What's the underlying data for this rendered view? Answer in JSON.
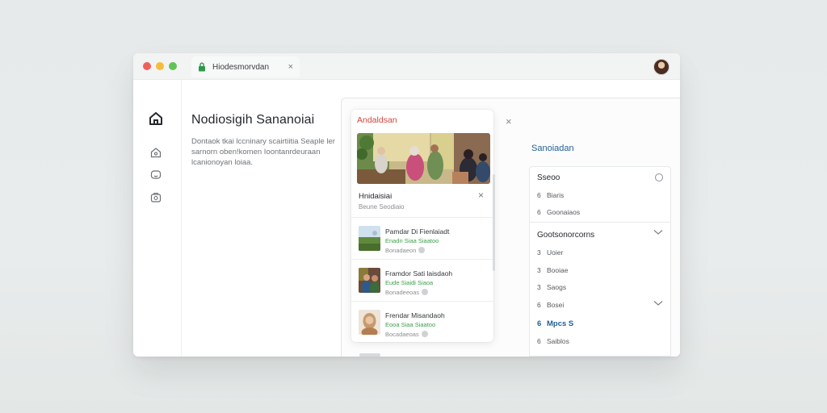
{
  "browser": {
    "tab_title": "Hiodesmorvdan",
    "tab_close": "×"
  },
  "intro": {
    "heading": "Nodiosigih Sananoiai",
    "body": "Dontaok tkai lccninary scairtiitia Seaple ler sarnorn oben!komen Ioontanrdeuraan lcanionoyan loiaa."
  },
  "card": {
    "tag": "Andaldsan",
    "header_title": "Hnidaisiai",
    "header_sub": "Beune Seodiaio",
    "close": "×",
    "items": [
      {
        "title": "Pamdar Di Fienlaiadt",
        "meta": "Enadn Siaa Siaatoo",
        "foot": "Bonadaeon"
      },
      {
        "title": "Framdor Sati laisdaoh",
        "meta": "Eude Siaidi Siaoa",
        "foot": "Bonadeeoas"
      },
      {
        "title": "Frendar Misandaoh",
        "meta": "Eooa Siaa Siaatoo",
        "foot": "Bocadaeoas"
      }
    ]
  },
  "panel": {
    "close": "×"
  },
  "right": {
    "title": "Sanoiadan",
    "group1": {
      "header": "Sseoo",
      "rows": [
        {
          "num": "6",
          "label": "Biaris"
        },
        {
          "num": "6",
          "label": "Goonaiaos"
        }
      ]
    },
    "group2": {
      "header": "Gootsonorcorns",
      "chevron": "⌄",
      "rows": [
        {
          "num": "3",
          "label": "Uoier",
          "active": false
        },
        {
          "num": "3",
          "label": "Booiae",
          "active": false
        },
        {
          "num": "3",
          "label": "Saogs",
          "active": false
        },
        {
          "num": "6",
          "label": "Bosei",
          "active": false
        },
        {
          "num": "6",
          "label": "Mpcs S",
          "active": true
        },
        {
          "num": "6",
          "label": "Saiblos",
          "active": false
        }
      ]
    }
  },
  "colors": {
    "accent_blue": "#1f5f96",
    "tag_red": "#d2453a",
    "meta_green": "#3aa04a"
  },
  "icons": [
    "lock-icon",
    "home-icon",
    "home-outline-icon",
    "chat-icon",
    "gallery-icon",
    "close-icon",
    "radio-icon",
    "chevron-down-icon"
  ]
}
